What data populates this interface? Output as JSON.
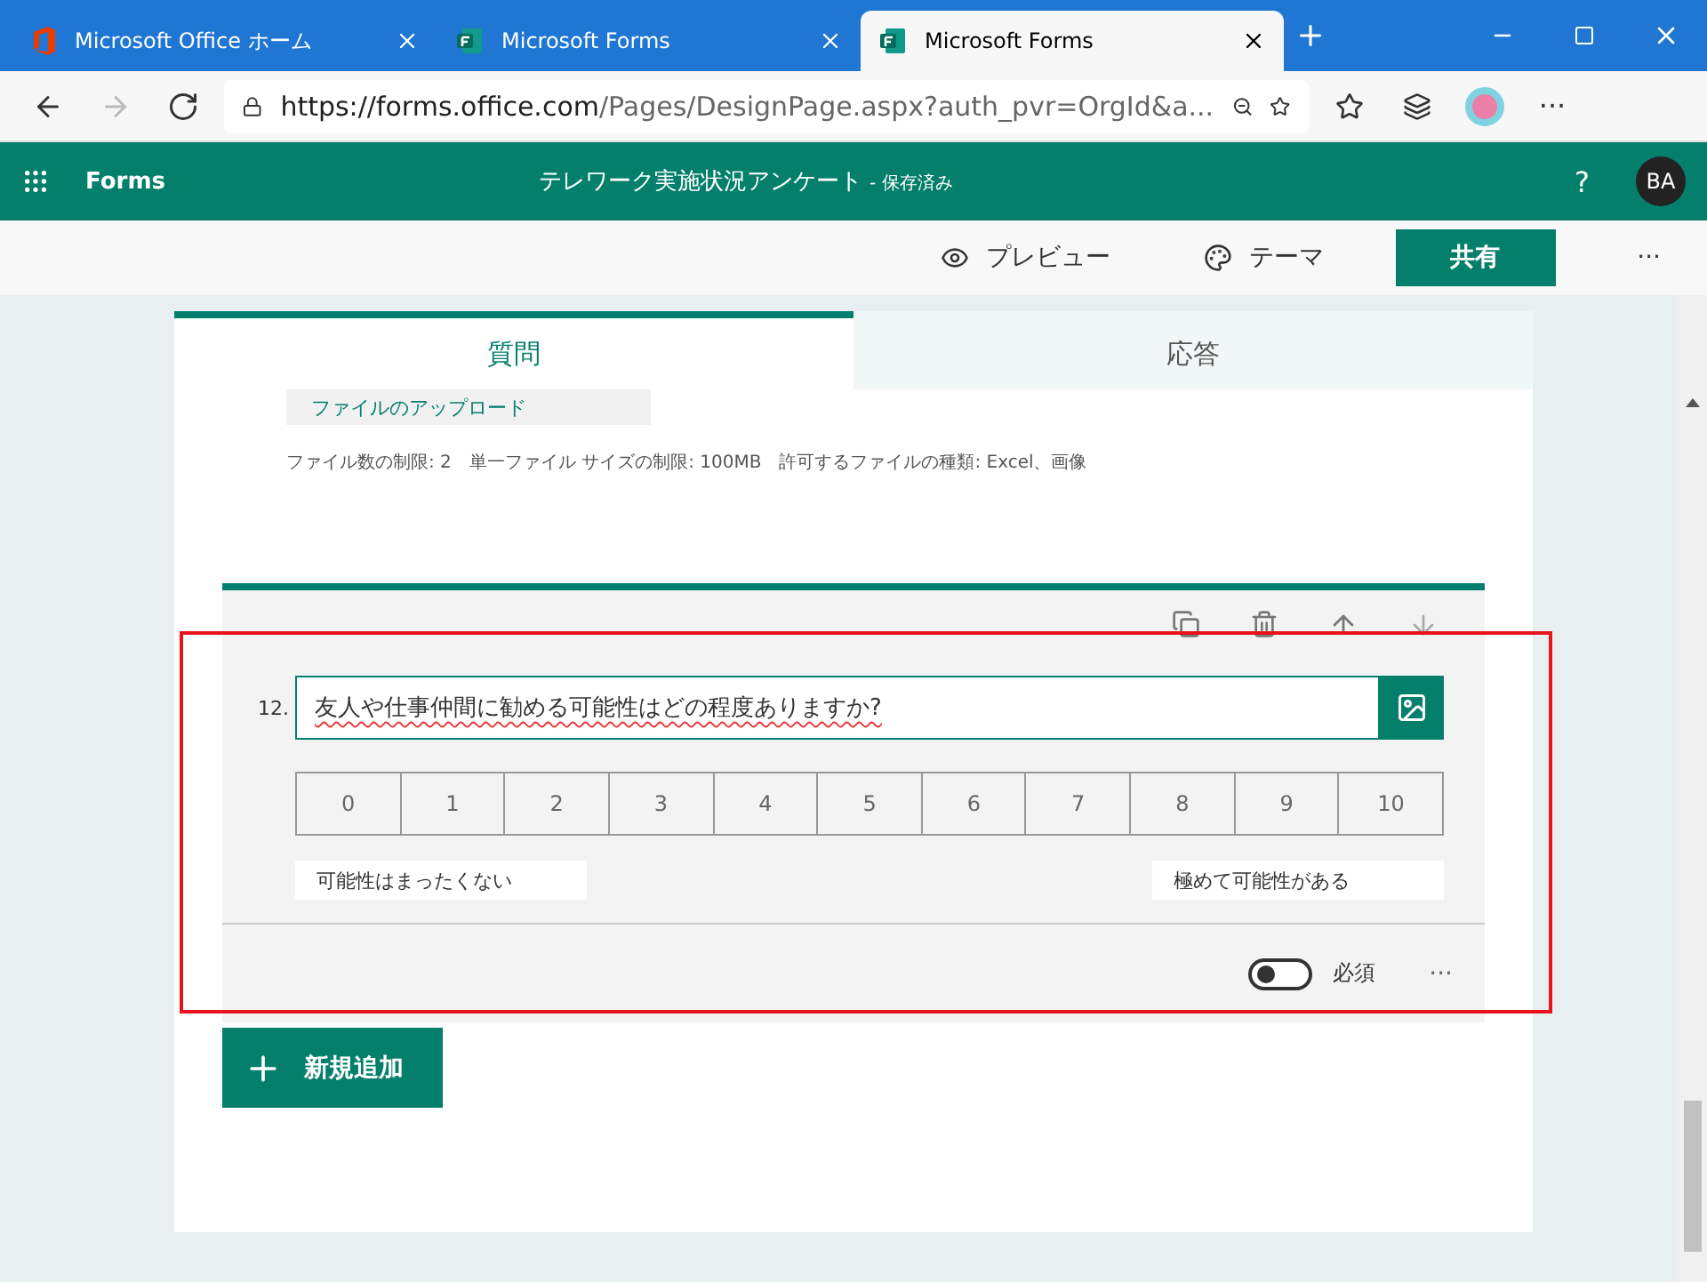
{
  "browser_tabs": [
    {
      "title": "Microsoft Office ホーム",
      "kind": "office",
      "selected": false
    },
    {
      "title": "Microsoft Forms",
      "kind": "forms",
      "selected": false
    },
    {
      "title": "Microsoft Forms",
      "kind": "forms",
      "selected": true
    }
  ],
  "address_bar": {
    "url_host": "https://forms.office.com",
    "url_path": "/Pages/DesignPage.aspx?auth_pvr=OrgId&a...",
    "menu": "···"
  },
  "app_header": {
    "app_name": "Forms",
    "form_title": "テレワーク実施状況アンケート",
    "save_status": "- 保存済み",
    "help": "?",
    "avatar": "BA"
  },
  "command_bar": {
    "preview": "プレビュー",
    "theme": "テーマ",
    "share": "共有",
    "more": "···"
  },
  "form_tabs": [
    {
      "label": "質問",
      "selected": true
    },
    {
      "label": "応答",
      "selected": false
    }
  ],
  "previous_question": {
    "upload_button": "ファイルのアップロード",
    "limits": "ファイル数の制限: 2　単一ファイル サイズの制限: 100MB　許可するファイルの種類: Excel、画像"
  },
  "question": {
    "number": "12.",
    "title": "友人や仕事仲間に勧める可能性はどの程度ありますか?",
    "scale": [
      "0",
      "1",
      "2",
      "3",
      "4",
      "5",
      "6",
      "7",
      "8",
      "9",
      "10"
    ],
    "low_label": "可能性はまったくない",
    "high_label": "極めて可能性がある",
    "required_label": "必須",
    "required": false,
    "more": "···"
  },
  "add_button": "新規追加"
}
